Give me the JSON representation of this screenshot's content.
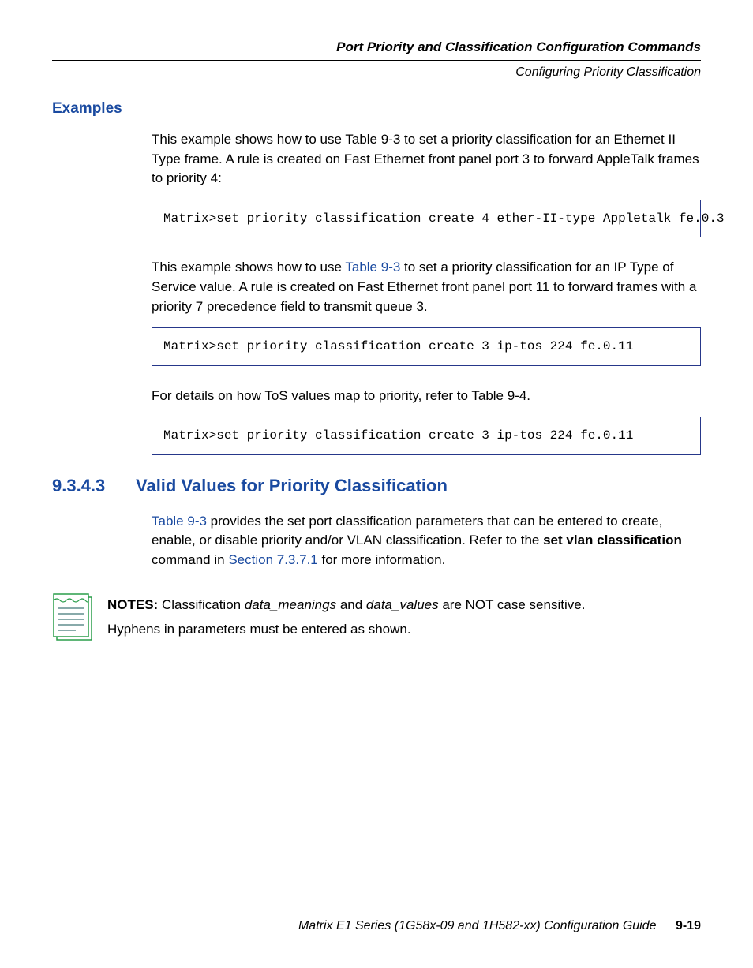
{
  "header": {
    "title": "Port Priority and Classification Configuration Commands",
    "subtitle": "Configuring Priority Classification"
  },
  "examples": {
    "heading": "Examples",
    "para1": "This example shows how to use Table 9-3 to set a priority classification for an Ethernet II Type frame. A rule is created on Fast Ethernet front panel port 3 to forward AppleTalk frames to priority 4:",
    "code1": "Matrix>set priority classification create 4 ether-II-type Appletalk fe.0.3 ",
    "para2_a": "This example shows how to use ",
    "para2_link": "Table 9-3",
    "para2_b": " to set a priority classification for an IP Type of Service value. A rule is created on Fast Ethernet front panel port 11 to forward frames with a priority 7 precedence field to transmit queue 3.",
    "code2": "Matrix>set priority classification create 3 ip-tos 224 fe.0.11 ",
    "para3": "For details on how ToS values map to priority, refer to Table 9-4.",
    "code3": "Matrix>set priority classification create 3 ip-tos 224 fe.0.11 "
  },
  "section": {
    "number": "9.3.4.3",
    "title": "Valid Values for Priority Classification",
    "para_a": "Table 9-3",
    "para_b": " provides the set port classification parameters that can be entered to create, enable, or disable priority and/or VLAN classification. Refer to the ",
    "para_c": "set vlan classification",
    "para_d": " command in ",
    "para_e": "Section 7.3.7.1",
    "para_f": " for more information."
  },
  "notes": {
    "label": "NOTES:",
    "line1_a": "  Classification ",
    "line1_b": "data_meanings",
    "line1_c": " and ",
    "line1_d": "data_values",
    "line1_e": " are NOT case sensitive.",
    "line2": "Hyphens in parameters must be entered as shown."
  },
  "footer": {
    "text": "Matrix E1 Series (1G58x-09 and 1H582-xx) Configuration Guide",
    "page": "9-19"
  }
}
